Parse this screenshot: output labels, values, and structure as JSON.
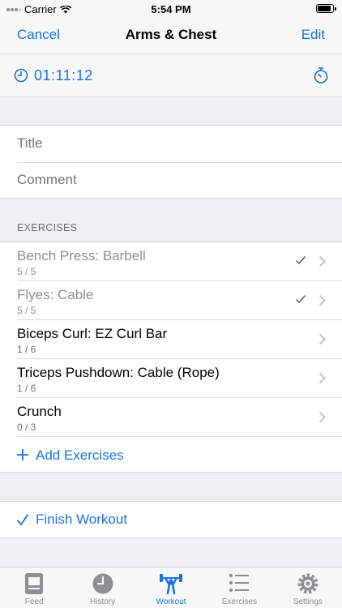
{
  "status_bar": {
    "carrier": "Carrier",
    "time": "5:54 PM"
  },
  "nav": {
    "cancel_label": "Cancel",
    "title": "Arms & Chest",
    "edit_label": "Edit"
  },
  "timer": {
    "elapsed": "01:11:12"
  },
  "details": {
    "title_placeholder": "Title",
    "comment_placeholder": "Comment"
  },
  "exercises": {
    "header": "EXERCISES",
    "items": [
      {
        "name": "Bench Press: Barbell",
        "count": "5 / 5",
        "done": true
      },
      {
        "name": "Flyes: Cable",
        "count": "5 / 5",
        "done": true
      },
      {
        "name": "Biceps Curl: EZ Curl Bar",
        "count": "1 / 6",
        "done": false
      },
      {
        "name": "Triceps Pushdown: Cable (Rope)",
        "count": "1 / 6",
        "done": false
      },
      {
        "name": "Crunch",
        "count": "0 / 3",
        "done": false
      }
    ],
    "add_label": "Add Exercises"
  },
  "finish": {
    "label": "Finish Workout"
  },
  "tabbar": {
    "items": [
      {
        "label": "Feed",
        "icon": "feed-icon"
      },
      {
        "label": "History",
        "icon": "history-icon"
      },
      {
        "label": "Workout",
        "icon": "workout-icon",
        "active": true
      },
      {
        "label": "Exercises",
        "icon": "exercises-list-icon"
      },
      {
        "label": "Settings",
        "icon": "settings-gear-icon"
      }
    ]
  },
  "colors": {
    "accent": "#1a73d9",
    "secondary_text": "#8e8e93",
    "placeholder": "#c4c4c8",
    "background": "#efeff4"
  }
}
